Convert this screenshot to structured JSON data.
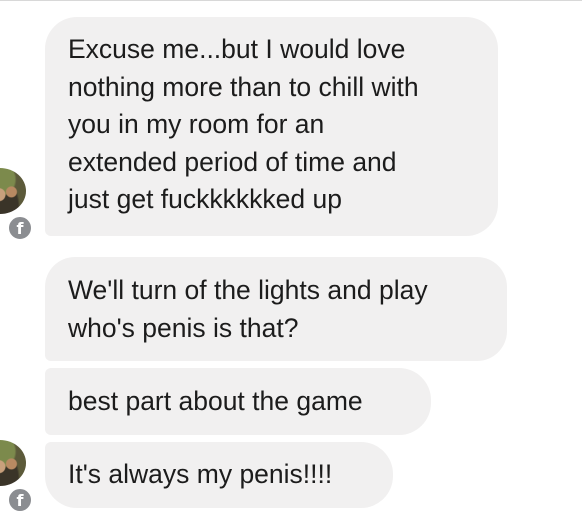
{
  "conversation": {
    "messages": [
      {
        "lines": [
          "Excuse me...but I would love",
          "nothing more than to chill with",
          "you in my room for an",
          "extended period of time and",
          "just get fuckkkkkked up"
        ]
      },
      {
        "lines": [
          "We'll turn of the lights and play",
          "who's penis is that?"
        ]
      },
      {
        "lines": [
          "best part about the game"
        ]
      },
      {
        "lines": [
          "It's always my penis!!!!"
        ]
      }
    ],
    "badge_glyph": "f",
    "icons": {
      "avatar": "sender-avatar-icon",
      "badge": "facebook-badge-icon"
    },
    "colors": {
      "bubble": "#f1f0f0",
      "text": "#1c1c1c",
      "badge": "#8b8d91",
      "background": "#ffffff"
    }
  }
}
